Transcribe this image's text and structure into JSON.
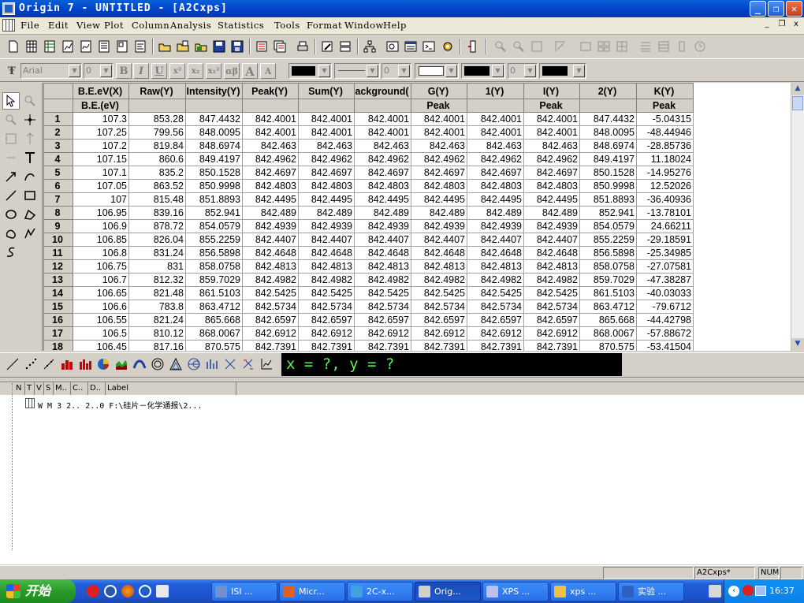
{
  "window": {
    "title": "Origin 7 - UNTITLED - [A2Cxps]",
    "min_glyph": "_",
    "max_glyph": "❐",
    "close_glyph": "✕",
    "mdi_min": "_",
    "mdi_restore": "❐",
    "mdi_close": "x"
  },
  "menu": [
    "File",
    "Edit",
    "View",
    "Plot",
    "Column",
    "Analysis",
    "Statistics",
    "Tools",
    "Format",
    "Window",
    "Help"
  ],
  "format_toolbar": {
    "font_name": "Arial",
    "font_size": "0",
    "bold": "B",
    "italic": "I",
    "underline": "U",
    "superscript": "x²",
    "subscript": "x₂",
    "sup_sub": "x₁²",
    "greek": "αβ",
    "increase_font": "A",
    "decrease_font": "A",
    "line_width": "0",
    "pattern_value": "0"
  },
  "worksheet": {
    "columns": [
      {
        "header": "B.E.eV(X)",
        "label": "B.E.(eV)"
      },
      {
        "header": "Raw(Y)",
        "label": ""
      },
      {
        "header": "Intensity(Y)",
        "label": ""
      },
      {
        "header": "Peak(Y)",
        "label": ""
      },
      {
        "header": "Sum(Y)",
        "label": ""
      },
      {
        "header": "ackground(",
        "label": ""
      },
      {
        "header": "G(Y)",
        "label": "Peak"
      },
      {
        "header": "1(Y)",
        "label": ""
      },
      {
        "header": "I(Y)",
        "label": "Peak"
      },
      {
        "header": "2(Y)",
        "label": ""
      },
      {
        "header": "K(Y)",
        "label": "Peak"
      }
    ],
    "rows": [
      {
        "n": "1",
        "cells": [
          "107.3",
          "853.28",
          "847.4432",
          "842.4001",
          "842.4001",
          "842.4001",
          "842.4001",
          "842.4001",
          "842.4001",
          "847.4432",
          "-5.04315"
        ]
      },
      {
        "n": "2",
        "cells": [
          "107.25",
          "799.56",
          "848.0095",
          "842.4001",
          "842.4001",
          "842.4001",
          "842.4001",
          "842.4001",
          "842.4001",
          "848.0095",
          "-48.44946"
        ]
      },
      {
        "n": "3",
        "cells": [
          "107.2",
          "819.84",
          "848.6974",
          "842.463",
          "842.463",
          "842.463",
          "842.463",
          "842.463",
          "842.463",
          "848.6974",
          "-28.85736"
        ]
      },
      {
        "n": "4",
        "cells": [
          "107.15",
          "860.6",
          "849.4197",
          "842.4962",
          "842.4962",
          "842.4962",
          "842.4962",
          "842.4962",
          "842.4962",
          "849.4197",
          "11.18024"
        ]
      },
      {
        "n": "5",
        "cells": [
          "107.1",
          "835.2",
          "850.1528",
          "842.4697",
          "842.4697",
          "842.4697",
          "842.4697",
          "842.4697",
          "842.4697",
          "850.1528",
          "-14.95276"
        ]
      },
      {
        "n": "6",
        "cells": [
          "107.05",
          "863.52",
          "850.9998",
          "842.4803",
          "842.4803",
          "842.4803",
          "842.4803",
          "842.4803",
          "842.4803",
          "850.9998",
          "12.52026"
        ]
      },
      {
        "n": "7",
        "cells": [
          "107",
          "815.48",
          "851.8893",
          "842.4495",
          "842.4495",
          "842.4495",
          "842.4495",
          "842.4495",
          "842.4495",
          "851.8893",
          "-36.40936"
        ]
      },
      {
        "n": "8",
        "cells": [
          "106.95",
          "839.16",
          "852.941",
          "842.489",
          "842.489",
          "842.489",
          "842.489",
          "842.489",
          "842.489",
          "852.941",
          "-13.78101"
        ]
      },
      {
        "n": "9",
        "cells": [
          "106.9",
          "878.72",
          "854.0579",
          "842.4939",
          "842.4939",
          "842.4939",
          "842.4939",
          "842.4939",
          "842.4939",
          "854.0579",
          "24.66211"
        ]
      },
      {
        "n": "10",
        "cells": [
          "106.85",
          "826.04",
          "855.2259",
          "842.4407",
          "842.4407",
          "842.4407",
          "842.4407",
          "842.4407",
          "842.4407",
          "855.2259",
          "-29.18591"
        ]
      },
      {
        "n": "11",
        "cells": [
          "106.8",
          "831.24",
          "856.5898",
          "842.4648",
          "842.4648",
          "842.4648",
          "842.4648",
          "842.4648",
          "842.4648",
          "856.5898",
          "-25.34985"
        ]
      },
      {
        "n": "12",
        "cells": [
          "106.75",
          "831",
          "858.0758",
          "842.4813",
          "842.4813",
          "842.4813",
          "842.4813",
          "842.4813",
          "842.4813",
          "858.0758",
          "-27.07581"
        ]
      },
      {
        "n": "13",
        "cells": [
          "106.7",
          "812.32",
          "859.7029",
          "842.4982",
          "842.4982",
          "842.4982",
          "842.4982",
          "842.4982",
          "842.4982",
          "859.7029",
          "-47.38287"
        ]
      },
      {
        "n": "14",
        "cells": [
          "106.65",
          "821.48",
          "861.5103",
          "842.5425",
          "842.5425",
          "842.5425",
          "842.5425",
          "842.5425",
          "842.5425",
          "861.5103",
          "-40.03033"
        ]
      },
      {
        "n": "15",
        "cells": [
          "106.6",
          "783.8",
          "863.4712",
          "842.5734",
          "842.5734",
          "842.5734",
          "842.5734",
          "842.5734",
          "842.5734",
          "863.4712",
          "-79.6712"
        ]
      },
      {
        "n": "16",
        "cells": [
          "106.55",
          "821.24",
          "865.668",
          "842.6597",
          "842.6597",
          "842.6597",
          "842.6597",
          "842.6597",
          "842.6597",
          "865.668",
          "-44.42798"
        ]
      },
      {
        "n": "17",
        "cells": [
          "106.5",
          "810.12",
          "868.0067",
          "842.6912",
          "842.6912",
          "842.6912",
          "842.6912",
          "842.6912",
          "842.6912",
          "868.0067",
          "-57.88672"
        ]
      },
      {
        "n": "18",
        "cells": [
          "106.45",
          "817.16",
          "870.575",
          "842.7391",
          "842.7391",
          "842.7391",
          "842.7391",
          "842.7391",
          "842.7391",
          "870.575",
          "-53.41504"
        ]
      }
    ]
  },
  "coord_readout": "x = ?, y = ?",
  "explorer": {
    "columns": [
      "N",
      "T",
      "V",
      "S",
      "M..",
      "C..",
      "D..",
      "Label"
    ],
    "row": "W M 3 2.. 2..0    F:\\硅片－化学通报\\2..."
  },
  "status": {
    "panel_name": "A2Cxps*",
    "num": "NUM"
  },
  "taskbar": {
    "start_label": "开始",
    "tasks": [
      {
        "label": "ISI ...",
        "color": "#7090d0"
      },
      {
        "label": "Micr...",
        "color": "#e06020"
      },
      {
        "label": "2C-x...",
        "color": "#40a0e0"
      },
      {
        "label": "Orig...",
        "color": "#d4d0c8"
      },
      {
        "label": "XPS ...",
        "color": "#c0c0f0"
      },
      {
        "label": "xps ...",
        "color": "#f0c040"
      },
      {
        "label": "实验 ...",
        "color": "#3060c0"
      }
    ],
    "clock": "16:37"
  },
  "colors": {
    "titlebar": "#0041c8",
    "coord_bg": "#000000",
    "coord_fg": "#5ef05e",
    "taskbar": "#245edb",
    "start_green": "#2a9a2a"
  }
}
